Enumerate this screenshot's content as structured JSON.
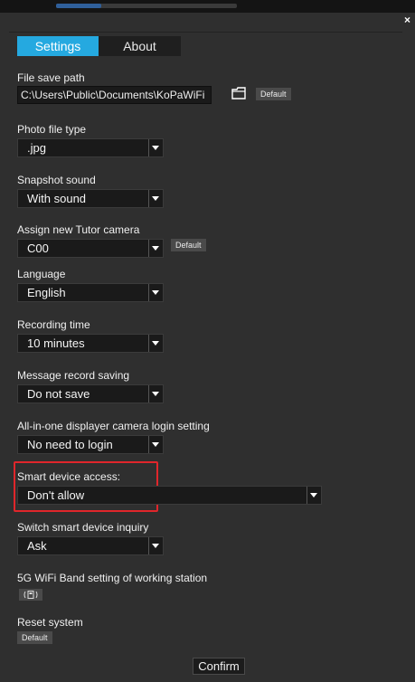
{
  "tabs": [
    {
      "label": "Settings",
      "active": true
    },
    {
      "label": "About",
      "active": false
    }
  ],
  "close_label": "×",
  "file_save_path": {
    "label": "File save path",
    "value": "C:\\Users\\Public\\Documents\\KoPaWiFi",
    "default_label": "Default",
    "icon": "folder-icon"
  },
  "photo_file_type": {
    "label": "Photo file type",
    "value": ".jpg"
  },
  "snapshot_sound": {
    "label": "Snapshot sound",
    "value": "With sound"
  },
  "tutor_camera": {
    "label": "Assign new Tutor camera",
    "value": "C00",
    "default_label": "Default"
  },
  "language": {
    "label": "Language",
    "value": "English"
  },
  "recording_time": {
    "label": "Recording time",
    "value": "10 minutes"
  },
  "message_record": {
    "label": "Message record saving",
    "value": "Do not save"
  },
  "camera_login": {
    "label": "All-in-one displayer camera login setting",
    "value": "No need to login"
  },
  "smart_device_access": {
    "label": "Smart device access:",
    "value": "Don't allow",
    "highlight_color": "#e0262b"
  },
  "smart_device_inquiry": {
    "label": "Switch smart device inquiry",
    "value": "Ask"
  },
  "wifi_band": {
    "label": "5G WiFi Band setting of working station",
    "icon": "wifi-band-toggle-icon"
  },
  "reset_system": {
    "label": "Reset system",
    "default_label": "Default"
  },
  "confirm_label": "Confirm",
  "colors": {
    "accent": "#25a9e0",
    "background": "#2f2f2f",
    "field": "#1a1a1a"
  }
}
